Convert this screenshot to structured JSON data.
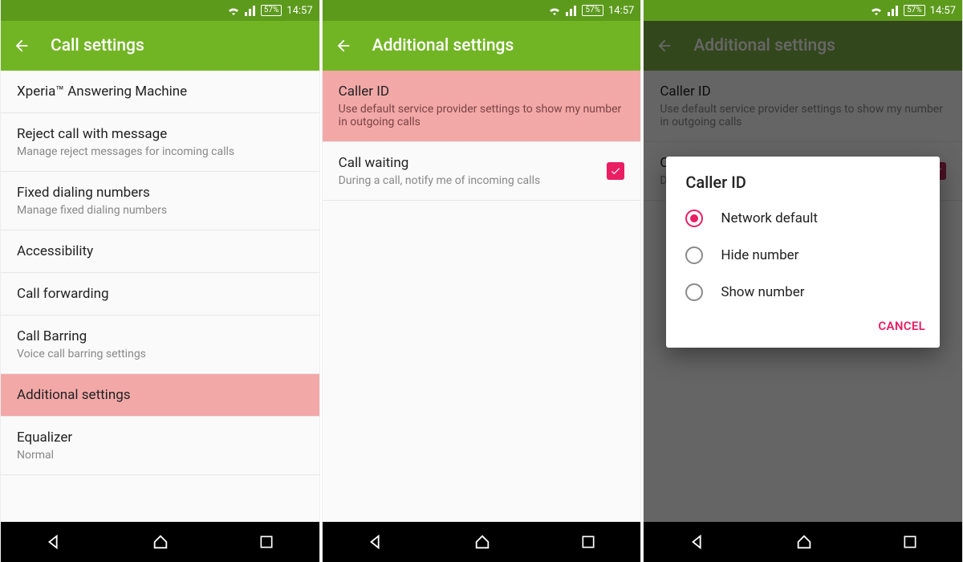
{
  "status": {
    "battery": "57%",
    "time": "14:57"
  },
  "screen1": {
    "title": "Call settings",
    "items": [
      {
        "primary": "Xperia™ Answering Machine",
        "secondary": ""
      },
      {
        "primary": "Reject call with message",
        "secondary": "Manage reject messages for incoming calls"
      },
      {
        "primary": "Fixed dialing numbers",
        "secondary": "Manage fixed dialing numbers"
      },
      {
        "primary": "Accessibility",
        "secondary": ""
      },
      {
        "primary": "Call forwarding",
        "secondary": ""
      },
      {
        "primary": "Call Barring",
        "secondary": "Voice call barring settings"
      },
      {
        "primary": "Additional settings",
        "secondary": ""
      },
      {
        "primary": "Equalizer",
        "secondary": "Normal"
      }
    ],
    "highlight_index": 6
  },
  "screen2": {
    "title": "Additional settings",
    "items": [
      {
        "primary": "Caller ID",
        "secondary": "Use default service provider settings to show my number in outgoing calls",
        "highlight": true
      },
      {
        "primary": "Call waiting",
        "secondary": "During a call, notify me of incoming calls",
        "checked": true
      }
    ]
  },
  "screen3": {
    "title": "Additional settings",
    "items": [
      {
        "primary": "Caller ID",
        "secondary": "Use default service provider settings to show my number in outgoing calls"
      },
      {
        "primary": "C",
        "secondary": "D"
      }
    ],
    "dialog": {
      "title": "Caller ID",
      "options": [
        {
          "label": "Network default",
          "selected": true
        },
        {
          "label": "Hide number",
          "selected": false
        },
        {
          "label": "Show number",
          "selected": false
        }
      ],
      "cancel": "CANCEL"
    }
  },
  "colors": {
    "accent": "#e91e63",
    "actionbar": "#72b524",
    "statusbar": "#5c9a1c",
    "highlight": "#f3a8a8"
  }
}
